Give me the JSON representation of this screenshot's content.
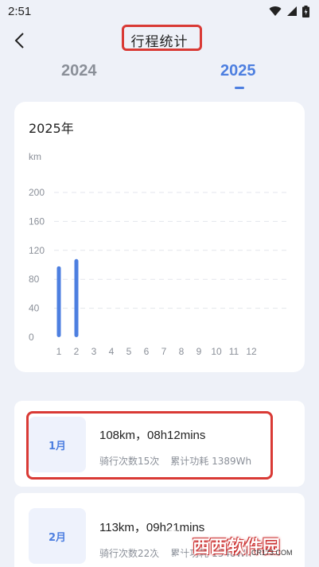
{
  "status_bar": {
    "time": "2:51"
  },
  "header": {
    "title": "行程统计"
  },
  "year_tabs": [
    {
      "label": "2024",
      "selected": false
    },
    {
      "label": "2025",
      "selected": true
    }
  ],
  "colors": {
    "accent": "#4d7fe0",
    "highlight": "#d93a35",
    "background": "#eef1f8"
  },
  "chart_data": {
    "type": "bar",
    "title": "2025年",
    "ylabel": "km",
    "ylim": [
      0,
      200
    ],
    "y_ticks": [
      0,
      40,
      80,
      120,
      160,
      200
    ],
    "categories": [
      "1",
      "2",
      "3",
      "4",
      "5",
      "6",
      "7",
      "8",
      "9",
      "10",
      "11",
      "12"
    ],
    "values": [
      98,
      108,
      0,
      0,
      0,
      0,
      0,
      0,
      0,
      0,
      0,
      0
    ],
    "grid": true
  },
  "months": [
    {
      "label": "1月",
      "summary": "108km，08h12mins",
      "rides": "骑行次数15次",
      "energy": "累计功耗 1389Wh"
    },
    {
      "label": "2月",
      "summary": "113km，09h21mins",
      "rides": "骑行次数22次",
      "energy": "累计功耗 1548Wh"
    }
  ],
  "watermark": {
    "text": "西西软件园",
    "sub": "CR173.COM"
  }
}
